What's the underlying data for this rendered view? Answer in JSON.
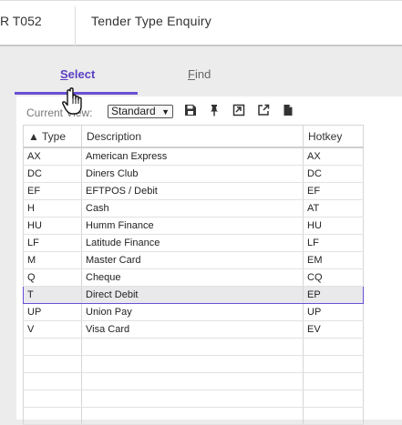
{
  "header": {
    "code": "R T052",
    "title": "Tender Type Enquiry"
  },
  "tabs": [
    {
      "label": "Select",
      "accesskey": "S",
      "rest": "elect",
      "active": true
    },
    {
      "label": "Find",
      "accesskey": "F",
      "rest": "ind",
      "active": false
    }
  ],
  "toolbar": {
    "current_view_label": "Current View:",
    "view_selected": "Standard",
    "icons": [
      "save-icon",
      "pin-icon",
      "restore-window-icon",
      "open-external-icon",
      "document-icon"
    ]
  },
  "grid": {
    "columns": [
      {
        "label": "Type",
        "sort": "▲"
      },
      {
        "label": "Description"
      },
      {
        "label": "Hotkey"
      }
    ],
    "rows": [
      {
        "type": "AX",
        "description": "American Express",
        "hotkey": "AX"
      },
      {
        "type": "DC",
        "description": "Diners Club",
        "hotkey": "DC"
      },
      {
        "type": "EF",
        "description": "EFTPOS / Debit",
        "hotkey": "EF"
      },
      {
        "type": "H",
        "description": "Cash",
        "hotkey": "AT"
      },
      {
        "type": "HU",
        "description": "Humm Finance",
        "hotkey": "HU"
      },
      {
        "type": "LF",
        "description": "Latitude Finance",
        "hotkey": "LF"
      },
      {
        "type": "M",
        "description": "Master Card",
        "hotkey": "EM"
      },
      {
        "type": "Q",
        "description": "Cheque",
        "hotkey": "CQ"
      },
      {
        "type": "T",
        "description": "Direct Debit",
        "hotkey": "EP",
        "selected": true
      },
      {
        "type": "UP",
        "description": "Union Pay",
        "hotkey": "UP"
      },
      {
        "type": "V",
        "description": "Visa Card",
        "hotkey": "EV"
      }
    ],
    "empty_rows": 5
  },
  "colors": {
    "accent": "#6a4fd6",
    "selected_row_bg": "#e9e9ec"
  }
}
